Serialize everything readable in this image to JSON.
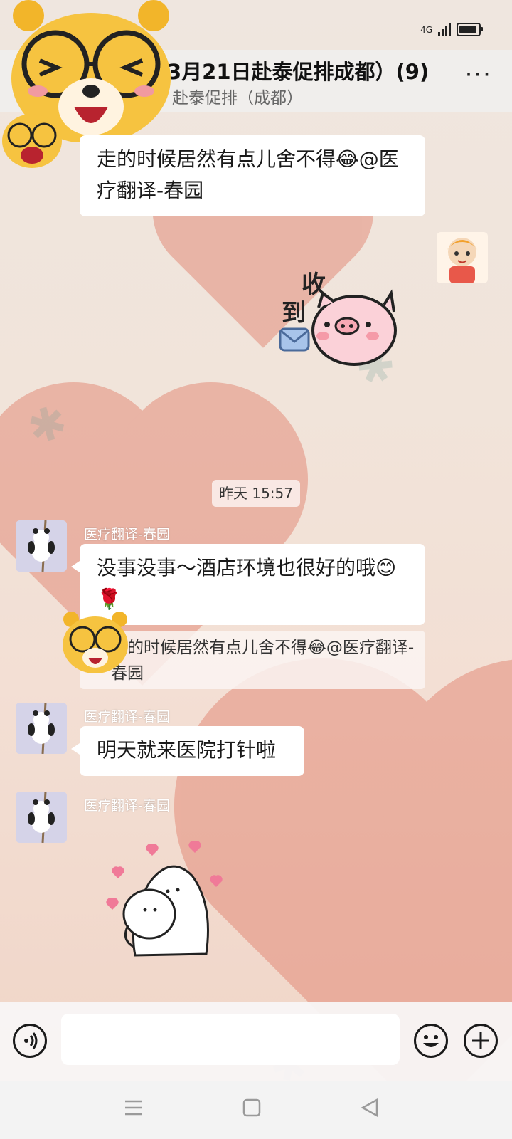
{
  "status": {
    "network": "4G"
  },
  "header": {
    "title": "3月21日赴泰促排成都）(9)",
    "subtitle": "赴泰促排（成都）",
    "more_label": "···"
  },
  "messages": {
    "first": {
      "text": "走的时候居然有点儿舍不得😂@医疗翻译-春园"
    },
    "sticker_received": {
      "text_top": "收",
      "text_bottom": "到"
    },
    "timestamp": "昨天 15:57",
    "reply": {
      "sender": "医疗翻译-春园",
      "text": "没事没事～酒店环境也很好的哦😊 🌹",
      "quote": "走的时候居然有点儿舍不得😂@医疗翻译-春园"
    },
    "msg3": {
      "sender": "医疗翻译-春园",
      "text": "明天就来医院打针啦"
    },
    "msg4": {
      "sender": "医疗翻译-春园"
    }
  },
  "colors": {
    "heart": "#e07b67",
    "bubble": "#ffffff",
    "bg": "#efe6df"
  }
}
